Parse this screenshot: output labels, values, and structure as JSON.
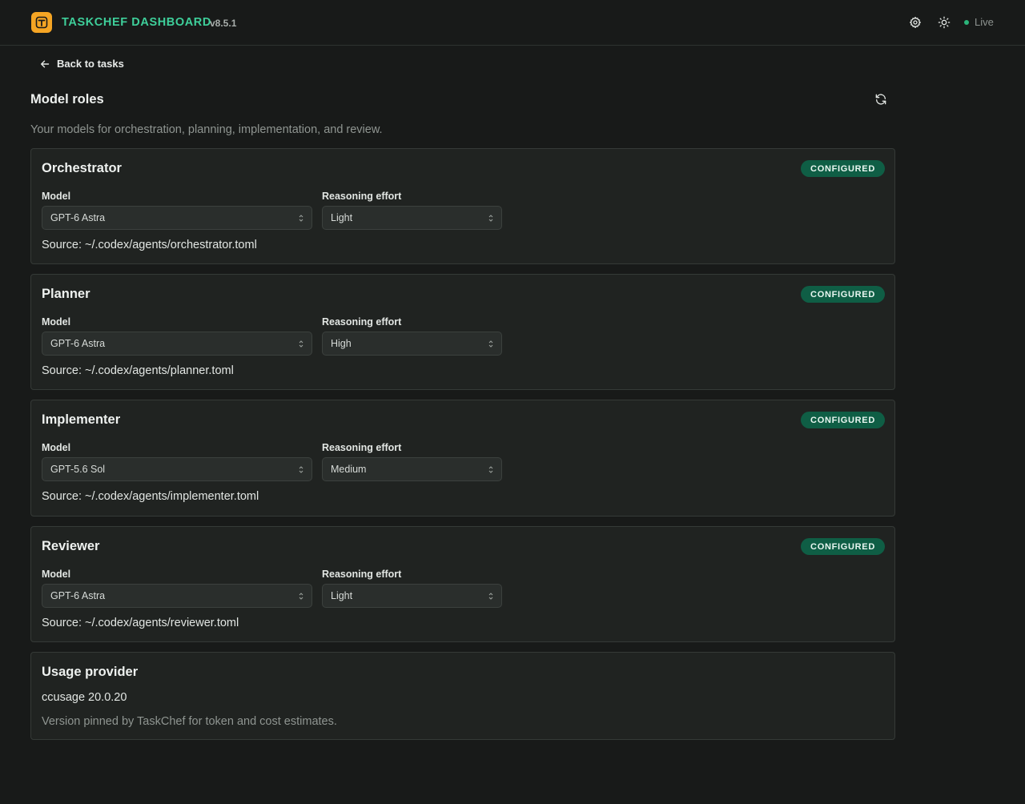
{
  "header": {
    "brand": "TASKCHEF DASHBOARD",
    "version": "v8.5.1",
    "status": "Live",
    "status_color": "#2bb57a",
    "brand_color": "#3ecf9a",
    "logo_color": "#f5a524",
    "icons": [
      "settings-gear-icon",
      "theme-sun-icon"
    ]
  },
  "nav": {
    "back_label": "Back to tasks"
  },
  "page": {
    "title": "Model roles",
    "subtitle": "Your models for orchestration, planning, implementation, and review."
  },
  "labels": {
    "model": "Model",
    "reasoning": "Reasoning effort"
  },
  "roles": [
    {
      "name": "Orchestrator",
      "badge": "CONFIGURED",
      "model": "GPT-6 Astra",
      "effort": "Light",
      "source": "Source: ~/.codex/agents/orchestrator.toml"
    },
    {
      "name": "Planner",
      "badge": "CONFIGURED",
      "model": "GPT-6 Astra",
      "effort": "High",
      "source": "Source: ~/.codex/agents/planner.toml"
    },
    {
      "name": "Implementer",
      "badge": "CONFIGURED",
      "model": "GPT-5.6 Sol",
      "effort": "Medium",
      "source": "Source: ~/.codex/agents/implementer.toml"
    },
    {
      "name": "Reviewer",
      "badge": "CONFIGURED",
      "model": "GPT-6 Astra",
      "effort": "Light",
      "source": "Source: ~/.codex/agents/reviewer.toml"
    }
  ],
  "usage": {
    "title": "Usage provider",
    "value": "ccusage 20.0.20",
    "note": "Version pinned by TaskChef for token and cost estimates."
  }
}
